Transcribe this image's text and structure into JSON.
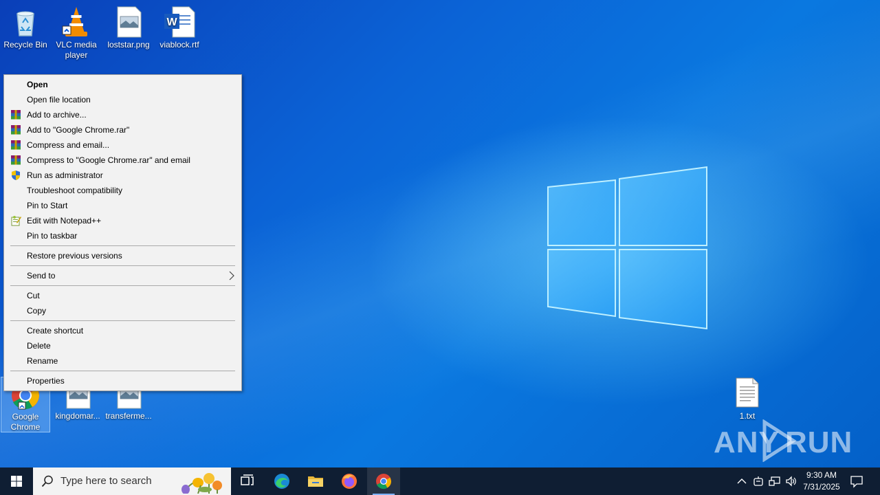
{
  "desktop": {
    "icons": [
      {
        "label": "Recycle Bin",
        "icon": "recycle-bin-icon"
      },
      {
        "label": "VLC media player",
        "icon": "vlc-icon"
      },
      {
        "label": "loststar.png",
        "icon": "image-file-icon"
      },
      {
        "label": "viablock.rtf",
        "icon": "word-document-icon"
      },
      {
        "label": "Google Chrome",
        "icon": "chrome-icon"
      },
      {
        "label": "kingdomar...",
        "icon": "image-file-icon"
      },
      {
        "label": "transferme...",
        "icon": "image-file-icon"
      },
      {
        "label": "1.txt",
        "icon": "text-file-icon"
      }
    ],
    "watermark": "ANY RUN"
  },
  "context_menu": {
    "items": [
      {
        "label": "Open",
        "bold": true
      },
      {
        "label": "Open file location"
      },
      {
        "label": "Add to archive...",
        "icon": "winrar-icon"
      },
      {
        "label": "Add to \"Google Chrome.rar\"",
        "icon": "winrar-icon"
      },
      {
        "label": "Compress and email...",
        "icon": "winrar-icon"
      },
      {
        "label": "Compress to \"Google Chrome.rar\" and email",
        "icon": "winrar-icon"
      },
      {
        "label": "Run as administrator",
        "icon": "uac-shield-icon"
      },
      {
        "label": "Troubleshoot compatibility"
      },
      {
        "label": "Pin to Start"
      },
      {
        "label": "Edit with Notepad++",
        "icon": "notepadpp-icon"
      },
      {
        "label": "Pin to taskbar"
      },
      {
        "label": "Restore previous versions"
      },
      {
        "label": "Send to",
        "submenu": true
      },
      {
        "label": "Cut"
      },
      {
        "label": "Copy"
      },
      {
        "label": "Create shortcut"
      },
      {
        "label": "Delete"
      },
      {
        "label": "Rename"
      },
      {
        "label": "Properties"
      }
    ]
  },
  "taskbar": {
    "search_placeholder": "Type here to search",
    "apps": [
      "task-view-icon",
      "edge-icon",
      "file-explorer-icon",
      "firefox-icon",
      "chrome-icon"
    ],
    "active_app": "chrome-icon",
    "clock": {
      "time": "9:30 AM",
      "date": "7/31/2025"
    },
    "tray_icons": [
      "chevron-up-icon",
      "network-agent-icon",
      "network-icon",
      "volume-icon",
      "action-center-icon"
    ]
  },
  "colors": {
    "taskbar": "#0f1e33",
    "menu_bg": "#f2f2f2",
    "accent": "#0078d7"
  }
}
